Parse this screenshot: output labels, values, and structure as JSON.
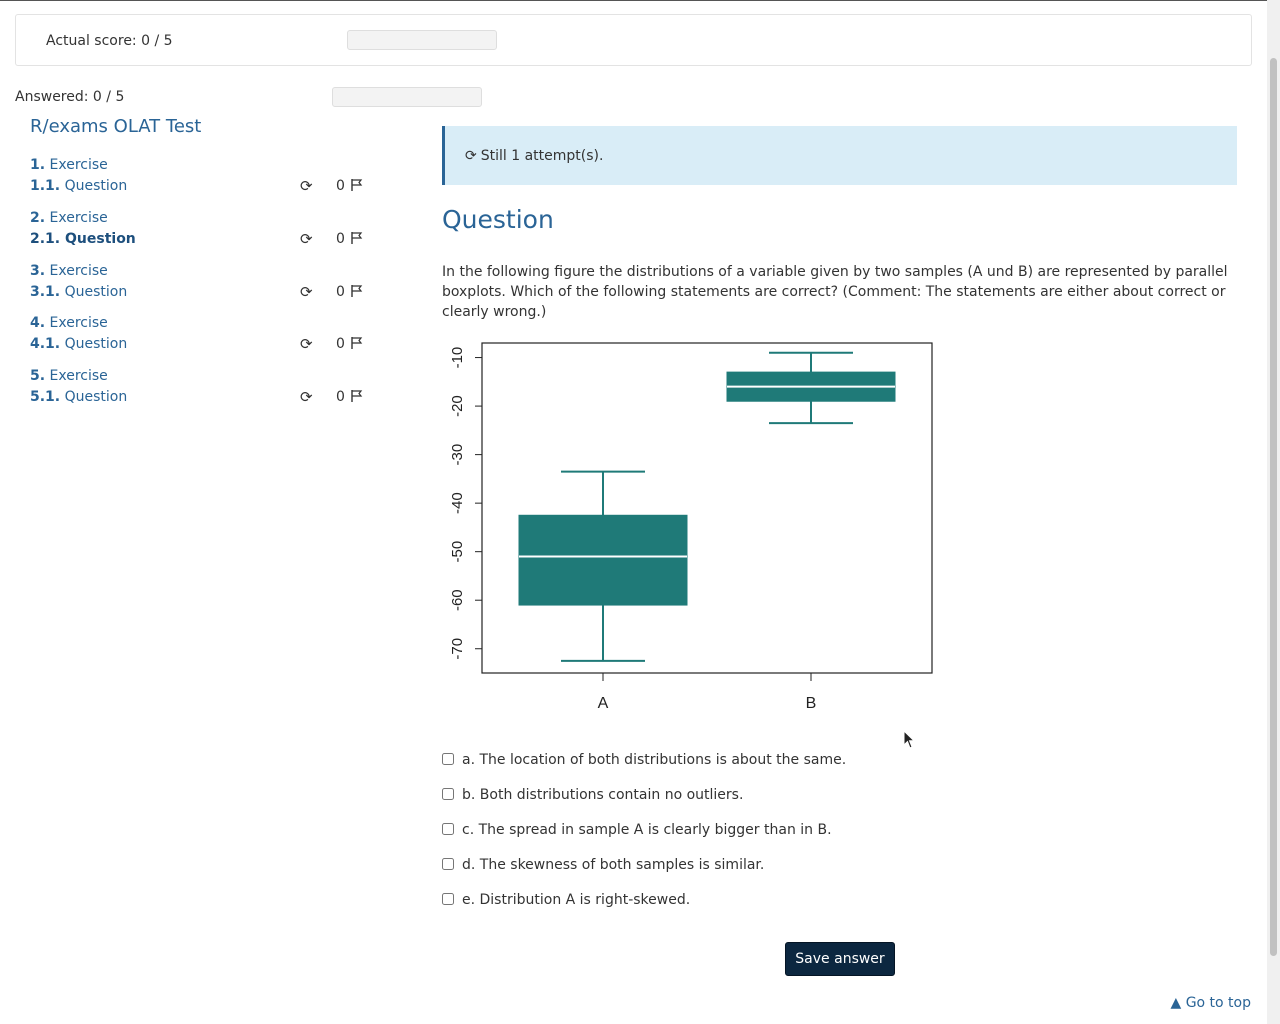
{
  "header": {
    "actual_score_label": "Actual score: 0 / 5",
    "actual_score_progress": 0,
    "answered_label": "Answered: 0 / 5",
    "answered_progress": 0
  },
  "menu": {
    "title": "R/exams OLAT Test",
    "items": [
      {
        "num": "1.",
        "exercise": "Exercise",
        "qnum": "1.1.",
        "question": "Question",
        "score": "0"
      },
      {
        "num": "2.",
        "exercise": "Exercise",
        "qnum": "2.1.",
        "question": "Question",
        "score": "0"
      },
      {
        "num": "3.",
        "exercise": "Exercise",
        "qnum": "3.1.",
        "question": "Question",
        "score": "0"
      },
      {
        "num": "4.",
        "exercise": "Exercise",
        "qnum": "4.1.",
        "question": "Question",
        "score": "0"
      },
      {
        "num": "5.",
        "exercise": "Exercise",
        "qnum": "5.1.",
        "question": "Question",
        "score": "0"
      }
    ],
    "active_index": 1
  },
  "alert": {
    "text": "Still 1 attempt(s)."
  },
  "question": {
    "heading": "Question",
    "text": "In the following figure the distributions of a variable given by two samples (A und B) are represented by parallel boxplots. Which of the following statements are correct? (Comment: The statements are either about correct or clearly wrong.)"
  },
  "chart_data": {
    "type": "boxplot",
    "categories": [
      "A",
      "B"
    ],
    "boxes": [
      {
        "name": "A",
        "whisker_low": -72.5,
        "q1": -61,
        "median": -51,
        "q3": -42.5,
        "whisker_high": -33.5
      },
      {
        "name": "B",
        "whisker_low": -23.5,
        "q1": -19,
        "median": -16,
        "q3": -13,
        "whisker_high": -9
      }
    ],
    "ylim": [
      -75,
      -7
    ],
    "yticks": [
      -10,
      -20,
      -30,
      -40,
      -50,
      -60,
      -70
    ],
    "box_color": "#1f7a78",
    "grid": false,
    "legend": "none"
  },
  "choices": [
    "a. The location of both distributions is about the same.",
    "b. Both distributions contain no outliers.",
    "c. The spread in sample A is clearly bigger than in B.",
    "d. The skewness of both samples is similar.",
    "e. Distribution A is right-skewed."
  ],
  "buttons": {
    "save_label": "Save answer"
  },
  "footer": {
    "go_top_label": "Go to top"
  },
  "colors": {
    "accent": "#2a6496",
    "alert_bg": "#d9edf7",
    "button_bg": "#0c2740"
  }
}
